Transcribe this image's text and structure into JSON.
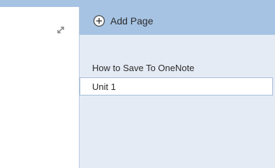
{
  "left_pane": {
    "expand_icon": "expand-diagonal-icon"
  },
  "page_pane": {
    "add_page": {
      "icon": "plus-circle-icon",
      "label": "Add Page"
    },
    "section_title": "How to Save To OneNote",
    "pages": [
      {
        "label": "Unit 1",
        "selected": true
      }
    ]
  },
  "colors": {
    "header_blue": "#a6c3e3",
    "pane_background": "#e5ebf5",
    "selected_page_background": "#ffffff"
  }
}
